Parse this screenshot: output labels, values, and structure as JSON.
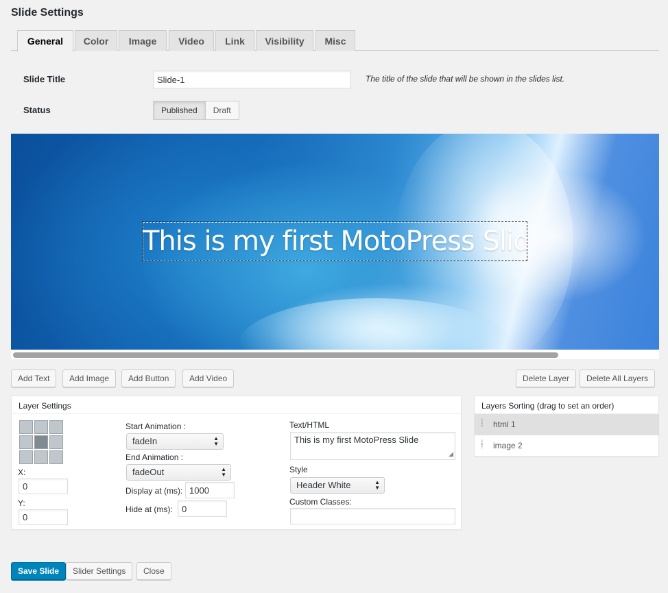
{
  "page": {
    "title": "Slide Settings"
  },
  "tabs": [
    {
      "label": "General",
      "active": true
    },
    {
      "label": "Color"
    },
    {
      "label": "Image"
    },
    {
      "label": "Video"
    },
    {
      "label": "Link"
    },
    {
      "label": "Visibility"
    },
    {
      "label": "Misc"
    }
  ],
  "general": {
    "slide_title_label": "Slide Title",
    "slide_title_value": "Slide-1",
    "slide_title_hint": "The title of the slide that will be shown in the slides list.",
    "status_label": "Status",
    "status_options": [
      "Published",
      "Draft"
    ],
    "status_selected": "Published"
  },
  "preview": {
    "layer_text": "This is my first MotoPress Slide"
  },
  "layer_buttons": {
    "add_text": "Add Text",
    "add_image": "Add Image",
    "add_button": "Add Button",
    "add_video": "Add Video",
    "delete_layer": "Delete Layer",
    "delete_all_layers": "Delete All Layers"
  },
  "layer_settings": {
    "title": "Layer Settings",
    "x_label": "X:",
    "x_value": "0",
    "y_label": "Y:",
    "y_value": "0",
    "start_animation_label": "Start Animation :",
    "start_animation_value": "fadeIn",
    "end_animation_label": "End Animation :",
    "end_animation_value": "fadeOut",
    "display_at_label": "Display at (ms):",
    "display_at_value": "1000",
    "hide_at_label": "Hide at (ms):",
    "hide_at_value": "0",
    "text_html_label": "Text/HTML",
    "text_html_value": "This is my first MotoPress Slide",
    "style_label": "Style",
    "style_value": "Header White",
    "custom_classes_label": "Custom Classes:",
    "custom_classes_value": ""
  },
  "layers_sorting": {
    "title": "Layers Sorting (drag to set an order)",
    "items": [
      "html 1",
      "image 2"
    ]
  },
  "footer": {
    "save_slide": "Save Slide",
    "slider_settings": "Slider Settings",
    "close": "Close"
  },
  "colors": {
    "primary": "#0085ba",
    "background": "#f1f1f1"
  }
}
